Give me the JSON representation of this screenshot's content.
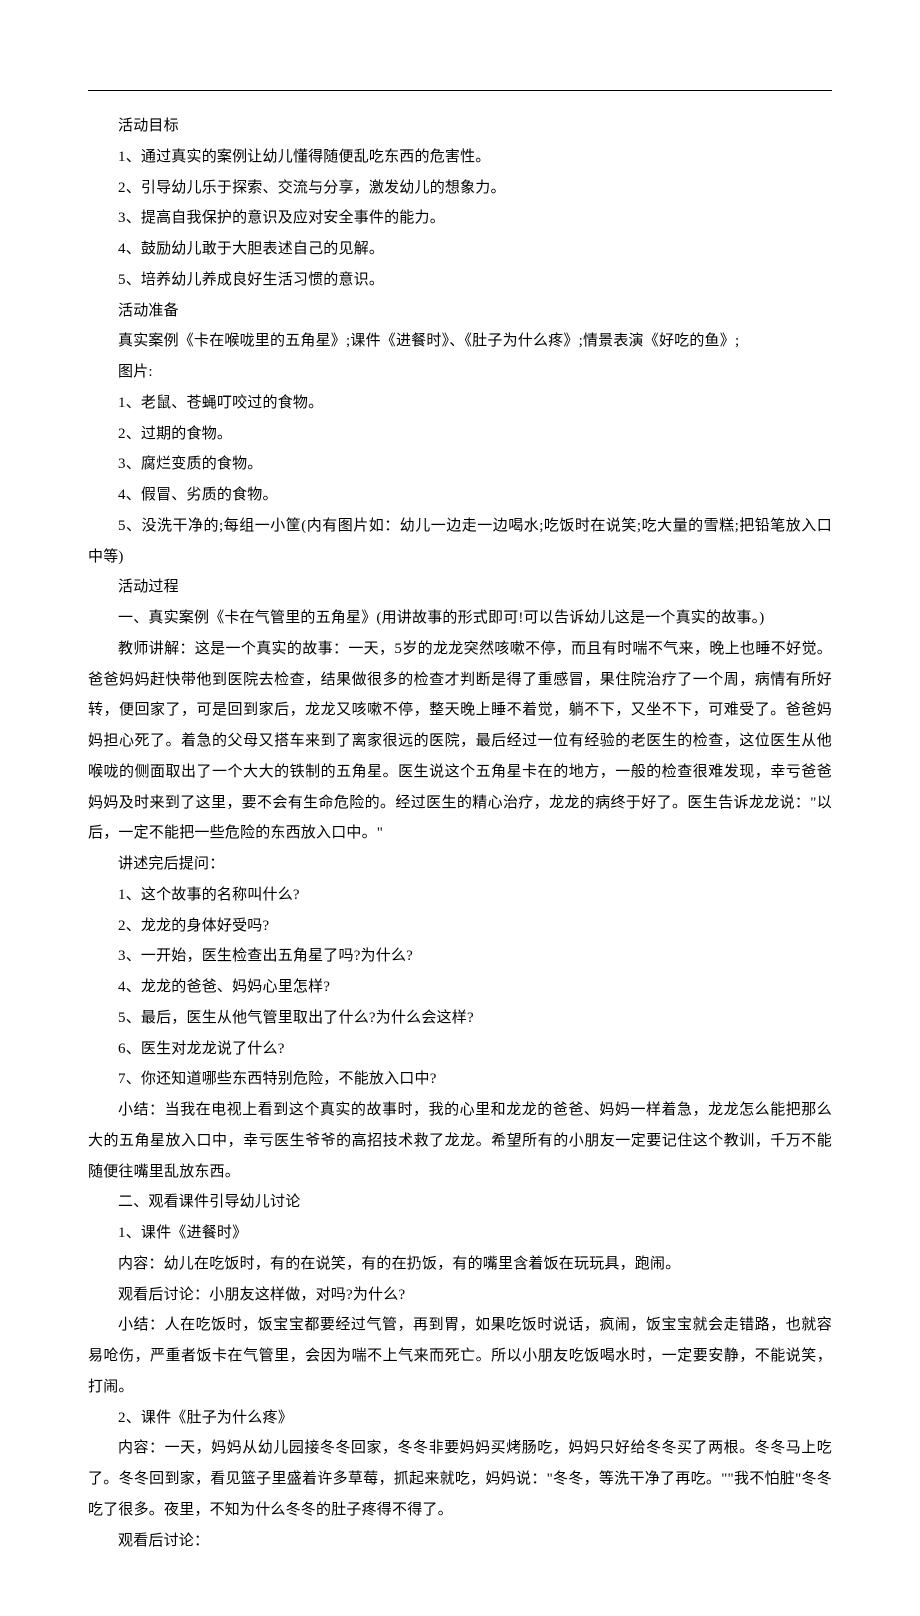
{
  "lines": [
    "活动目标",
    "1、通过真实的案例让幼儿懂得随便乱吃东西的危害性。",
    "2、引导幼儿乐于探索、交流与分享，激发幼儿的想象力。",
    "3、提高自我保护的意识及应对安全事件的能力。",
    "4、鼓励幼儿敢于大胆表述自己的见解。",
    "5、培养幼儿养成良好生活习惯的意识。",
    "活动准备",
    "真实案例《卡在喉咙里的五角星》;课件《进餐时》、《肚子为什么疼》;情景表演《好吃的鱼》;",
    "图片:",
    "1、老鼠、苍蝇叮咬过的食物。",
    "2、过期的食物。",
    "3、腐烂变质的食物。",
    "4、假冒、劣质的食物。",
    "5、没洗干净的;每组一小筐(内有图片如：幼儿一边走一边喝水;吃饭时在说笑;吃大量的雪糕;把铅笔放入口中等)",
    "活动过程",
    "一、真实案例《卡在气管里的五角星》(用讲故事的形式即可!可以告诉幼儿这是一个真实的故事。)",
    "教师讲解：这是一个真实的故事：一天，5岁的龙龙突然咳嗽不停，而且有时喘不气来，晚上也睡不好觉。爸爸妈妈赶快带他到医院去检查，结果做很多的检查才判断是得了重感冒，果住院治疗了一个周，病情有所好转，便回家了，可是回到家后，龙龙又咳嗽不停，整天晚上睡不着觉，躺不下，又坐不下，可难受了。爸爸妈妈担心死了。着急的父母又搭车来到了离家很远的医院，最后经过一位有经验的老医生的检查，这位医生从他喉咙的侧面取出了一个大大的铁制的五角星。医生说这个五角星卡在的地方，一般的检查很难发现，幸亏爸爸妈妈及时来到了这里，要不会有生命危险的。经过医生的精心治疗，龙龙的病终于好了。医生告诉龙龙说：\"以后，一定不能把一些危险的东西放入口中。\"",
    "讲述完后提问：",
    "1、这个故事的名称叫什么?",
    "2、龙龙的身体好受吗?",
    "3、一开始，医生检查出五角星了吗?为什么?",
    "4、龙龙的爸爸、妈妈心里怎样?",
    "5、最后，医生从他气管里取出了什么?为什么会这样?",
    "6、医生对龙龙说了什么?",
    "7、你还知道哪些东西特别危险，不能放入口中?",
    "小结：当我在电视上看到这个真实的故事时，我的心里和龙龙的爸爸、妈妈一样着急，龙龙怎么能把那么大的五角星放入口中，幸亏医生爷爷的高招技术救了龙龙。希望所有的小朋友一定要记住这个教训，千万不能随便往嘴里乱放东西。",
    "二、观看课件引导幼儿讨论",
    "1、课件《进餐时》",
    "内容：幼儿在吃饭时，有的在说笑，有的在扔饭，有的嘴里含着饭在玩玩具，跑闹。",
    "观看后讨论：小朋友这样做，对吗?为什么?",
    "小结：人在吃饭时，饭宝宝都要经过气管，再到胃，如果吃饭时说话，疯闹，饭宝宝就会走错路，也就容易呛伤，严重者饭卡在气管里，会因为喘不上气来而死亡。所以小朋友吃饭喝水时，一定要安静，不能说笑，打闹。",
    "2、课件《肚子为什么疼》",
    "内容：一天，妈妈从幼儿园接冬冬回家，冬冬非要妈妈买烤肠吃，妈妈只好给冬冬买了两根。冬冬马上吃了。冬冬回到家，看见篮子里盛着许多草莓，抓起来就吃，妈妈说：\"冬冬，等洗干净了再吃。\"\"我不怕脏\"冬冬吃了很多。夜里，不知为什么冬冬的肚子疼得不得了。",
    "观看后讨论："
  ]
}
